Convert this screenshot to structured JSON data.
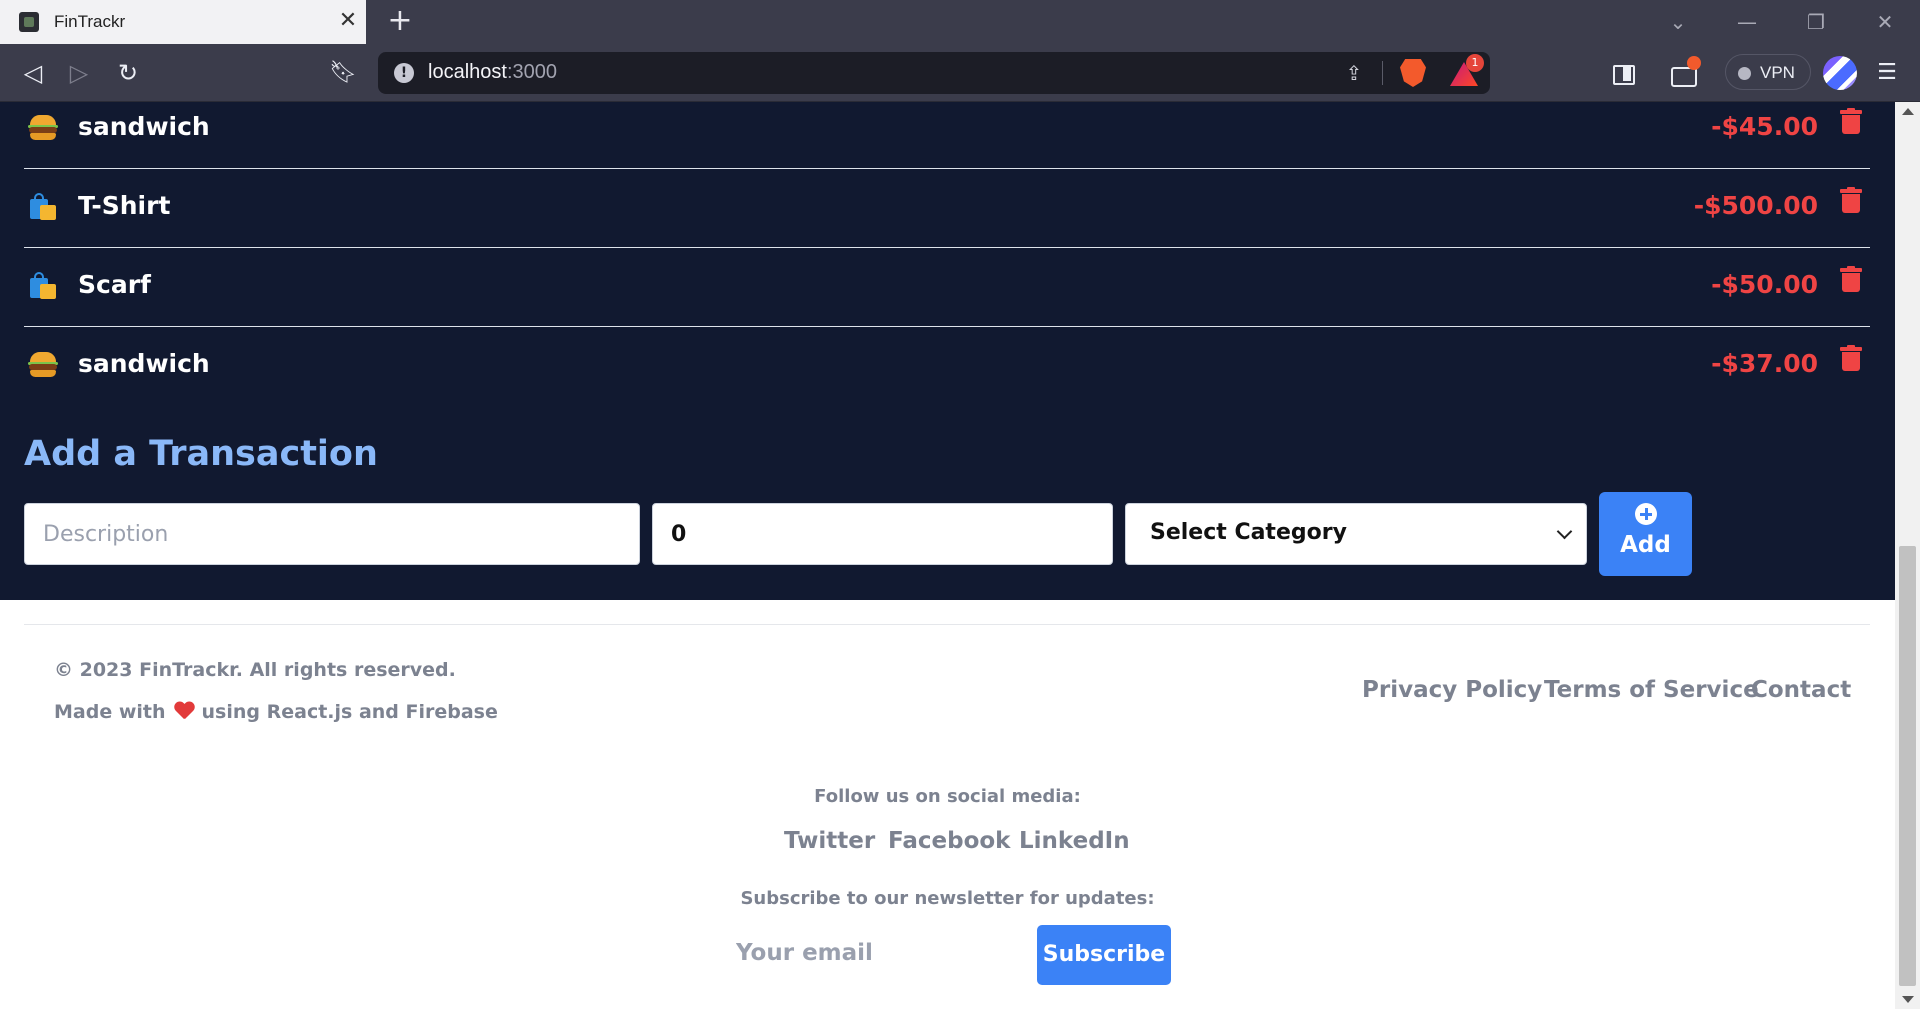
{
  "browser": {
    "tab_title": "FinTrackr",
    "tab_close": "✕",
    "new_tab": "+",
    "url_host": "localhost",
    "url_port": ":3000",
    "rewards_count": "1",
    "vpn_label": "VPN",
    "accent": "#f35a2c"
  },
  "transactions": [
    {
      "description": "sandwich",
      "amount": "-$45.00",
      "icon": "burger-icon"
    },
    {
      "description": "T-Shirt",
      "amount": "-$500.00",
      "icon": "shopping-bags-icon"
    },
    {
      "description": "Scarf",
      "amount": "-$50.00",
      "icon": "shopping-bags-icon"
    },
    {
      "description": "sandwich",
      "amount": "-$37.00",
      "icon": "burger-icon"
    }
  ],
  "add_form": {
    "title": "Add a Transaction",
    "description_placeholder": "Description",
    "amount_value": "0",
    "category_selected": "Select Category",
    "add_label": "Add"
  },
  "footer": {
    "copyright": "© 2023 FinTrackr. All rights reserved.",
    "made_with_prefix": "Made with",
    "made_with_suffix": "using React.js and Firebase",
    "links": [
      "Privacy Policy",
      "Terms of Service",
      "Contact"
    ],
    "follow_text": "Follow us on social media:",
    "social": [
      "Twitter",
      "Facebook",
      "LinkedIn"
    ],
    "subscribe_text": "Subscribe to our newsletter for updates:",
    "email_placeholder": "Your email",
    "subscribe_label": "Subscribe"
  },
  "colors": {
    "page_dark": "#111930",
    "expense": "#ef4444",
    "primary": "#3b82f6",
    "heading": "#8ab8f8"
  }
}
